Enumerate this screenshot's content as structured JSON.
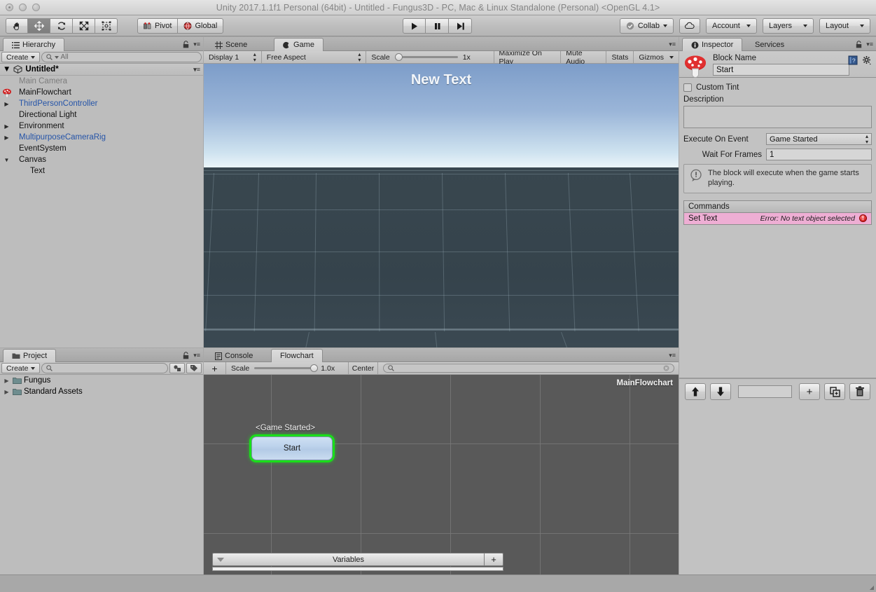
{
  "window": {
    "title": "Unity 2017.1.1f1 Personal (64bit) - Untitled - Fungus3D - PC, Mac & Linux Standalone (Personal) <OpenGL 4.1>"
  },
  "toolbar": {
    "tools": [
      {
        "name": "hand-tool",
        "icon": "hand-icon",
        "active": false
      },
      {
        "name": "move-tool",
        "icon": "move-icon",
        "active": true
      },
      {
        "name": "rotate-tool",
        "icon": "rotate-icon",
        "active": false
      },
      {
        "name": "scale-tool",
        "icon": "scale-icon",
        "active": false
      },
      {
        "name": "rect-tool",
        "icon": "rect-transform-icon",
        "active": false
      }
    ],
    "pivot_label": "Pivot",
    "global_label": "Global",
    "play_label": "play-icon",
    "pause_label": "pause-icon",
    "step_label": "step-icon",
    "collab_label": "Collab",
    "cloud_label": "cloud-icon",
    "account_label": "Account",
    "layers_label": "Layers",
    "layout_label": "Layout"
  },
  "hierarchy": {
    "tab_label": "Hierarchy",
    "create_label": "Create",
    "search_placeholder": "All",
    "scene_name": "Untitled*",
    "items": [
      {
        "label": "Main Camera",
        "indent": 1,
        "twisty": "",
        "style": "inactive",
        "icon": ""
      },
      {
        "label": "MainFlowchart",
        "indent": 1,
        "twisty": "",
        "style": "normal",
        "icon": "fungus-mushroom-icon"
      },
      {
        "label": "ThirdPersonController",
        "indent": 1,
        "twisty": "right",
        "style": "prefab",
        "icon": ""
      },
      {
        "label": "Directional Light",
        "indent": 1,
        "twisty": "",
        "style": "normal",
        "icon": ""
      },
      {
        "label": "Environment",
        "indent": 1,
        "twisty": "right",
        "style": "normal",
        "icon": ""
      },
      {
        "label": "MultipurposeCameraRig",
        "indent": 1,
        "twisty": "right",
        "style": "prefab",
        "icon": ""
      },
      {
        "label": "EventSystem",
        "indent": 1,
        "twisty": "",
        "style": "normal",
        "icon": ""
      },
      {
        "label": "Canvas",
        "indent": 1,
        "twisty": "down",
        "style": "normal",
        "icon": ""
      },
      {
        "label": "Text",
        "indent": 2,
        "twisty": "",
        "style": "normal",
        "icon": ""
      }
    ]
  },
  "project": {
    "tab_label": "Project",
    "create_label": "Create",
    "search_placeholder": "",
    "items": [
      {
        "label": "Fungus"
      },
      {
        "label": "Standard Assets"
      }
    ]
  },
  "gameview": {
    "scene_tab": "Scene",
    "game_tab": "Game",
    "display_label": "Display 1",
    "aspect_label": "Free Aspect",
    "scale_label": "Scale",
    "scale_value": "1x",
    "maximize_label": "Maximize On Play",
    "mute_label": "Mute Audio",
    "stats_label": "Stats",
    "gizmos_label": "Gizmos",
    "overlay_text": "New Text"
  },
  "flowchart": {
    "console_tab": "Console",
    "flowchart_tab": "Flowchart",
    "add_label": "+",
    "scale_label": "Scale",
    "scale_value": "1.0x",
    "center_label": "Center",
    "search_placeholder": "",
    "chart_name": "MainFlowchart",
    "blocks": [
      {
        "event_label": "<Game Started>",
        "name": "Start",
        "selected": true
      }
    ],
    "variables_label": "Variables",
    "variables_add": "+"
  },
  "inspector": {
    "inspector_tab": "Inspector",
    "services_tab": "Services",
    "block_name_label": "Block Name",
    "block_name_value": "Start",
    "custom_tint_label": "Custom Tint",
    "custom_tint_checked": false,
    "description_label": "Description",
    "description_value": "",
    "execute_on_event_label": "Execute On Event",
    "execute_on_event_value": "Game Started",
    "wait_for_frames_label": "Wait For Frames",
    "wait_for_frames_value": "1",
    "help_text": "The block will execute when the game starts playing.",
    "commands_header": "Commands",
    "commands": [
      {
        "name": "Set Text",
        "error": "Error: No text object selected",
        "has_error": true
      }
    ],
    "cmd_toolbar": {
      "up_label": "move-up-icon",
      "down_label": "move-down-icon",
      "add_label": "+",
      "duplicate_label": "duplicate-icon",
      "delete_label": "trash-icon"
    }
  },
  "colors": {
    "error_pink": "#eeaed4",
    "selection_green": "#19e019",
    "prefab_blue": "#2554a8",
    "panel_grey": "#c2c2c2",
    "flow_bg": "#595959"
  }
}
